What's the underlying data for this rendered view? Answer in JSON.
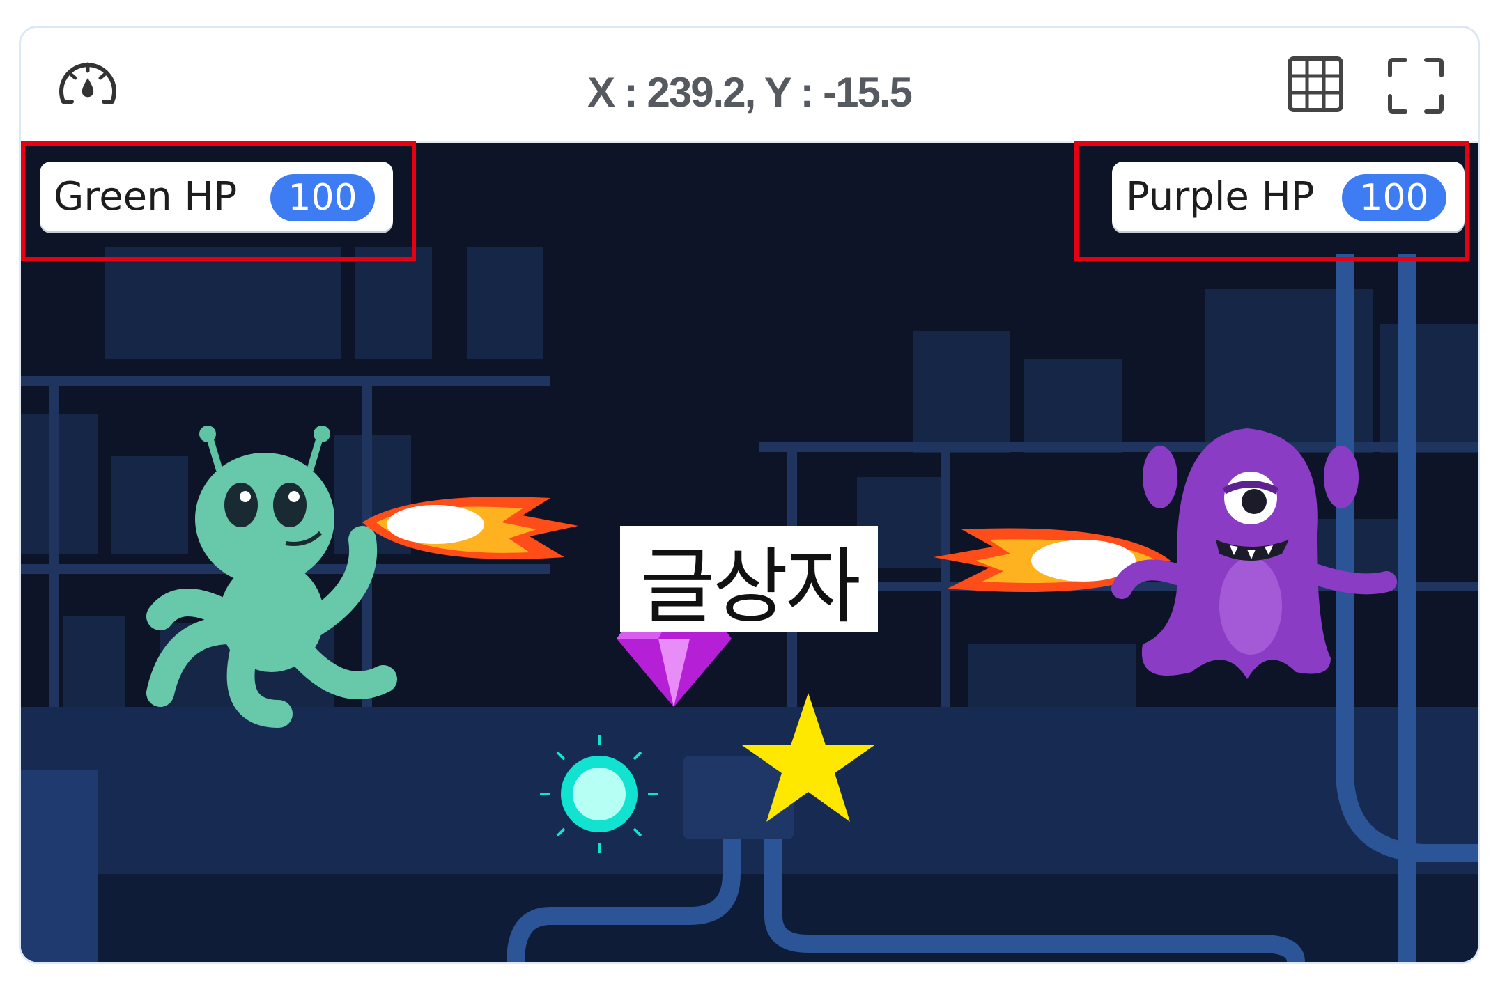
{
  "toolbar": {
    "coordinates": "X : 239.2, Y : -15.5",
    "speed_icon": "speedometer-icon",
    "grid_icon": "grid-icon",
    "fullscreen_icon": "fullscreen-icon"
  },
  "hud": {
    "green": {
      "label": "Green HP",
      "value": "100"
    },
    "purple": {
      "label": "Purple HP",
      "value": "100"
    }
  },
  "stage": {
    "textbox": "글상자",
    "sprites": [
      "green-alien",
      "purple-monster",
      "fireball-left",
      "fireball-right",
      "purple-gem",
      "yellow-star",
      "cyan-burst"
    ]
  },
  "colors": {
    "highlight": "#e60012",
    "hp_badge": "#3d7cf2",
    "stage_background": "#0d1428"
  }
}
